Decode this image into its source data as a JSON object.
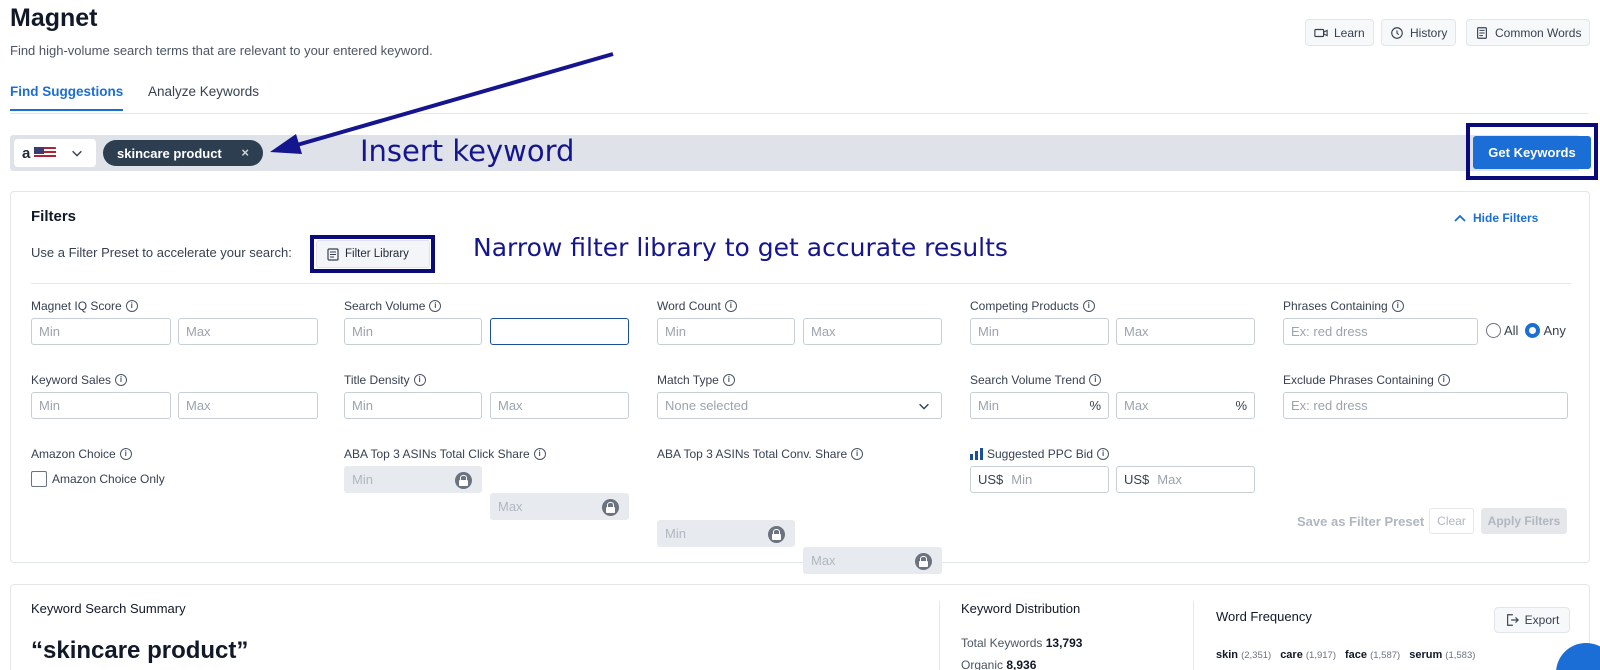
{
  "header": {
    "title": "Magnet",
    "subtitle": "Find high-volume search terms that are relevant to your entered keyword.",
    "buttons": {
      "learn": "Learn",
      "history": "History",
      "common_words": "Common Words"
    }
  },
  "tabs": [
    {
      "label": "Find Suggestions",
      "active": true
    },
    {
      "label": "Analyze Keywords",
      "active": false
    }
  ],
  "search": {
    "marketplace_logo": "a",
    "keyword_chip": "skincare product",
    "chip_remove": "×",
    "get_keywords": "Get Keywords"
  },
  "annotations": {
    "insert_keyword": "Insert keyword",
    "filter_library": "Narrow filter library to get accurate results"
  },
  "filters": {
    "title": "Filters",
    "hide": "Hide Filters",
    "preset_text": "Use a Filter Preset to accelerate your search:",
    "filter_library": "Filter Library",
    "fields": {
      "magnet_iq": "Magnet IQ Score",
      "search_volume": "Search Volume",
      "word_count": "Word Count",
      "competing_products": "Competing Products",
      "phrases_containing": "Phrases Containing",
      "keyword_sales": "Keyword Sales",
      "title_density": "Title Density",
      "match_type": "Match Type",
      "sv_trend": "Search Volume Trend",
      "exclude_phrases": "Exclude Phrases Containing",
      "amazon_choice": "Amazon Choice",
      "aba_click": "ABA Top 3 ASINs Total Click Share",
      "aba_conv": "ABA Top 3 ASINs Total Conv. Share",
      "ppc_bid": "Suggested PPC Bid"
    },
    "placeholders": {
      "min": "Min",
      "max": "Max",
      "phrase_example": "Ex: red dress",
      "none_selected": "None selected"
    },
    "percent": "%",
    "currency": "US$",
    "radio_all": "All",
    "radio_any": "Any",
    "amazon_choice_only": "Amazon Choice Only",
    "save_preset": "Save as Filter Preset",
    "clear": "Clear",
    "apply": "Apply Filters"
  },
  "summary": {
    "title": "Keyword Search Summary",
    "keyword": "“skincare product”",
    "distribution_title": "Keyword Distribution",
    "total_label": "Total Keywords",
    "total_value": "13,793",
    "organic_label": "Organic",
    "organic_value": "8,936",
    "word_freq_title": "Word Frequency",
    "export": "Export",
    "words": [
      {
        "word": "skin",
        "count": "(2,351)"
      },
      {
        "word": "care",
        "count": "(1,917)"
      },
      {
        "word": "face",
        "count": "(1,587)"
      },
      {
        "word": "serum",
        "count": "(1,583)"
      }
    ]
  },
  "colors": {
    "accent": "#1b6ed6",
    "annotation": "#15158f",
    "chip": "#2c3e50"
  }
}
